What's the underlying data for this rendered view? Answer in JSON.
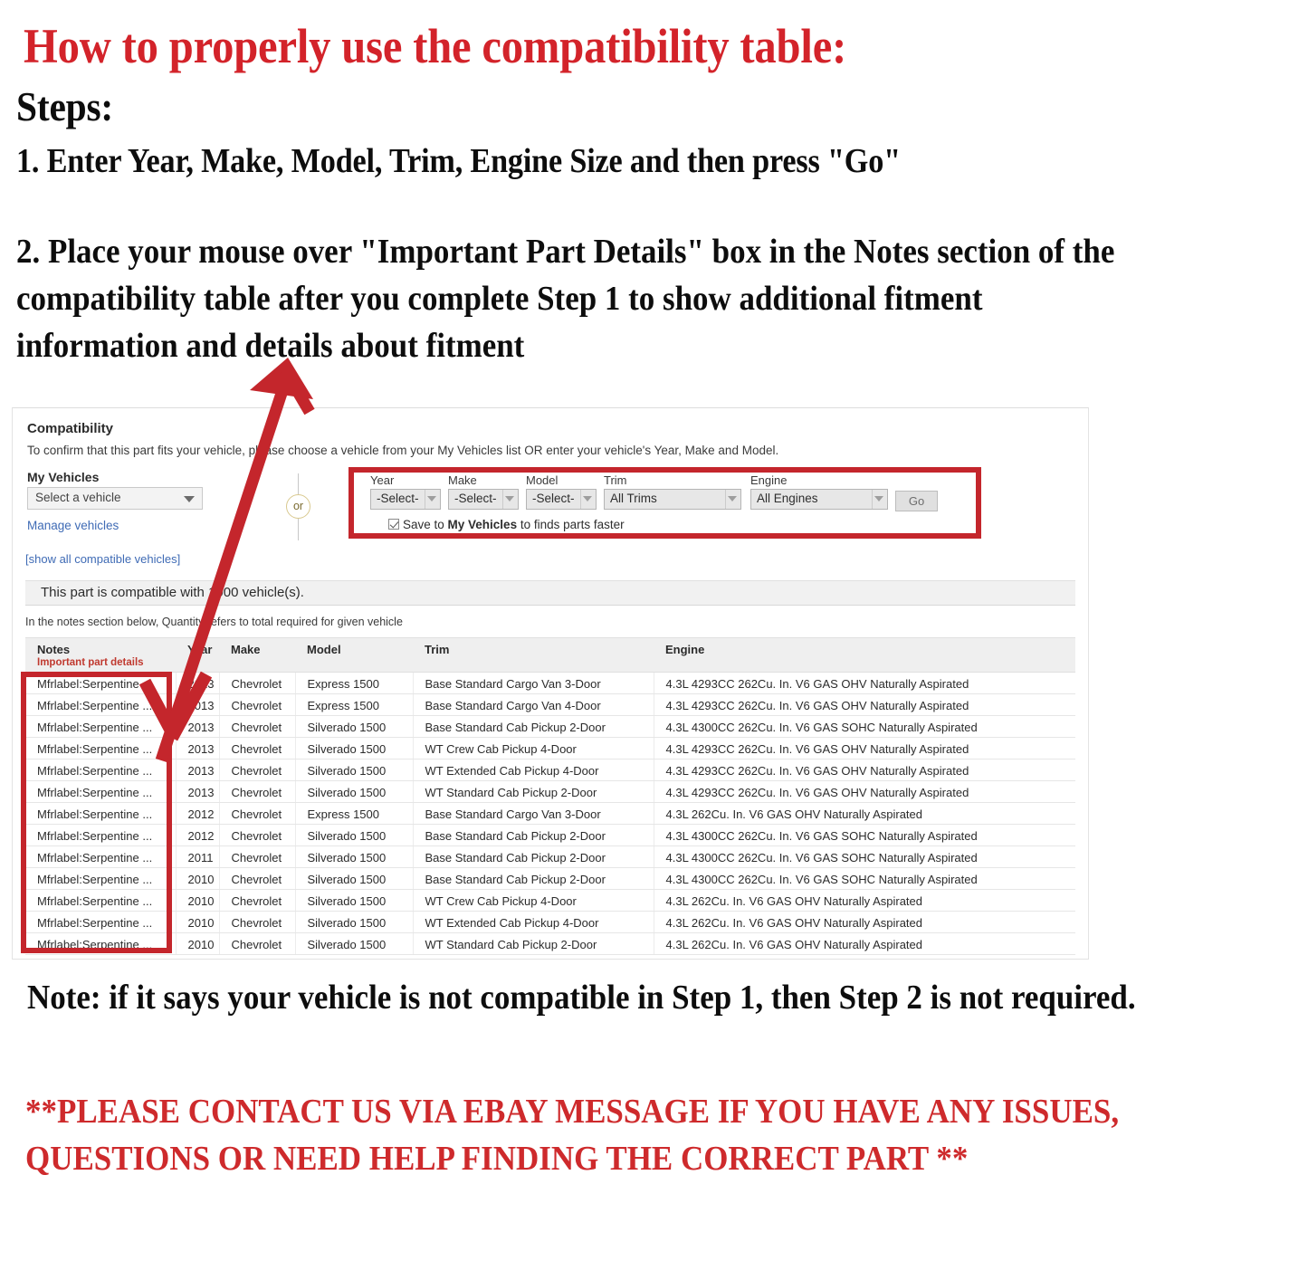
{
  "headings": {
    "title": "How to properly use the compatibility table:",
    "steps_label": "Steps:",
    "step_one": "1. Enter Year, Make, Model, Trim, Engine Size and then press \"Go\"",
    "step_two": "2. Place your mouse over \"Important Part Details\" box in the Notes section of the compatibility table after you complete Step 1 to show additional fitment information and details about fitment",
    "note": "Note: if it says your vehicle is not compatible in Step 1, then Step 2 is not required.",
    "contact": "**PLEASE CONTACT US VIA EBAY MESSAGE IF YOU HAVE ANY ISSUES, QUESTIONS OR NEED HELP FINDING THE CORRECT PART **"
  },
  "colors": {
    "red": "#D3232A",
    "box_red": "#C4262C",
    "link_blue": "#3f6bb5",
    "important_red": "#C0392F"
  },
  "compat": {
    "title": "Compatibility",
    "subtitle": "To confirm that this part fits your vehicle, please choose a vehicle from your My Vehicles list OR enter your vehicle's Year, Make and Model.",
    "my_vehicles_label": "My Vehicles",
    "vehicle_select_value": "Select a vehicle",
    "manage_link": "Manage vehicles",
    "show_all_link": "[show all compatible vehicles]",
    "or_text": "or",
    "fields": [
      {
        "label": "Year",
        "value": "-Select-"
      },
      {
        "label": "Make",
        "value": "-Select-"
      },
      {
        "label": "Model",
        "value": "-Select-"
      },
      {
        "label": "Trim",
        "value": "All Trims"
      },
      {
        "label": "Engine",
        "value": "All Engines"
      }
    ],
    "go_label": "Go",
    "save_prefix": "Save to ",
    "save_bold": "My Vehicles",
    "save_suffix": " to finds parts faster",
    "banner": "This part is compatible with 1000 vehicle(s).",
    "qty_note": "In the notes section below, Quantity refers to total required for given vehicle"
  },
  "table": {
    "headers": {
      "notes": "Notes",
      "notes_sub": "Important part details",
      "year": "Year",
      "make": "Make",
      "model": "Model",
      "trim": "Trim",
      "engine": "Engine"
    },
    "rows": [
      {
        "notes": "Mfrlabel:Serpentine ...",
        "year": "2013",
        "make": "Chevrolet",
        "model": "Express 1500",
        "trim": "Base Standard Cargo Van 3-Door",
        "engine": "4.3L 4293CC 262Cu. In. V6 GAS OHV Naturally Aspirated"
      },
      {
        "notes": "Mfrlabel:Serpentine ...",
        "year": "2013",
        "make": "Chevrolet",
        "model": "Express 1500",
        "trim": "Base Standard Cargo Van 4-Door",
        "engine": "4.3L 4293CC 262Cu. In. V6 GAS OHV Naturally Aspirated"
      },
      {
        "notes": "Mfrlabel:Serpentine ...",
        "year": "2013",
        "make": "Chevrolet",
        "model": "Silverado 1500",
        "trim": "Base Standard Cab Pickup 2-Door",
        "engine": "4.3L 4300CC 262Cu. In. V6 GAS SOHC Naturally Aspirated"
      },
      {
        "notes": "Mfrlabel:Serpentine ...",
        "year": "2013",
        "make": "Chevrolet",
        "model": "Silverado 1500",
        "trim": "WT Crew Cab Pickup 4-Door",
        "engine": "4.3L 4293CC 262Cu. In. V6 GAS OHV Naturally Aspirated"
      },
      {
        "notes": "Mfrlabel:Serpentine ...",
        "year": "2013",
        "make": "Chevrolet",
        "model": "Silverado 1500",
        "trim": "WT Extended Cab Pickup 4-Door",
        "engine": "4.3L 4293CC 262Cu. In. V6 GAS OHV Naturally Aspirated"
      },
      {
        "notes": "Mfrlabel:Serpentine ...",
        "year": "2013",
        "make": "Chevrolet",
        "model": "Silverado 1500",
        "trim": "WT Standard Cab Pickup 2-Door",
        "engine": "4.3L 4293CC 262Cu. In. V6 GAS OHV Naturally Aspirated"
      },
      {
        "notes": "Mfrlabel:Serpentine ...",
        "year": "2012",
        "make": "Chevrolet",
        "model": "Express 1500",
        "trim": "Base Standard Cargo Van 3-Door",
        "engine": "4.3L 262Cu. In. V6 GAS OHV Naturally Aspirated"
      },
      {
        "notes": "Mfrlabel:Serpentine ...",
        "year": "2012",
        "make": "Chevrolet",
        "model": "Silverado 1500",
        "trim": "Base Standard Cab Pickup 2-Door",
        "engine": "4.3L 4300CC 262Cu. In. V6 GAS SOHC Naturally Aspirated"
      },
      {
        "notes": "Mfrlabel:Serpentine ...",
        "year": "2011",
        "make": "Chevrolet",
        "model": "Silverado 1500",
        "trim": "Base Standard Cab Pickup 2-Door",
        "engine": "4.3L 4300CC 262Cu. In. V6 GAS SOHC Naturally Aspirated"
      },
      {
        "notes": "Mfrlabel:Serpentine ...",
        "year": "2010",
        "make": "Chevrolet",
        "model": "Silverado 1500",
        "trim": "Base Standard Cab Pickup 2-Door",
        "engine": "4.3L 4300CC 262Cu. In. V6 GAS SOHC Naturally Aspirated"
      },
      {
        "notes": "Mfrlabel:Serpentine ...",
        "year": "2010",
        "make": "Chevrolet",
        "model": "Silverado 1500",
        "trim": "WT Crew Cab Pickup 4-Door",
        "engine": "4.3L 262Cu. In. V6 GAS OHV Naturally Aspirated"
      },
      {
        "notes": "Mfrlabel:Serpentine ...",
        "year": "2010",
        "make": "Chevrolet",
        "model": "Silverado 1500",
        "trim": "WT Extended Cab Pickup 4-Door",
        "engine": "4.3L 262Cu. In. V6 GAS OHV Naturally Aspirated"
      },
      {
        "notes": "Mfrlabel:Serpentine ...",
        "year": "2010",
        "make": "Chevrolet",
        "model": "Silverado 1500",
        "trim": "WT Standard Cab Pickup 2-Door",
        "engine": "4.3L 262Cu. In. V6 GAS OHV Naturally Aspirated"
      }
    ]
  },
  "annotations": {
    "arrow": "double-headed-arrow",
    "form_highlight": "red-rectangle-around-vehicle-selector",
    "notes_highlight": "red-rectangle-around-notes-column"
  }
}
